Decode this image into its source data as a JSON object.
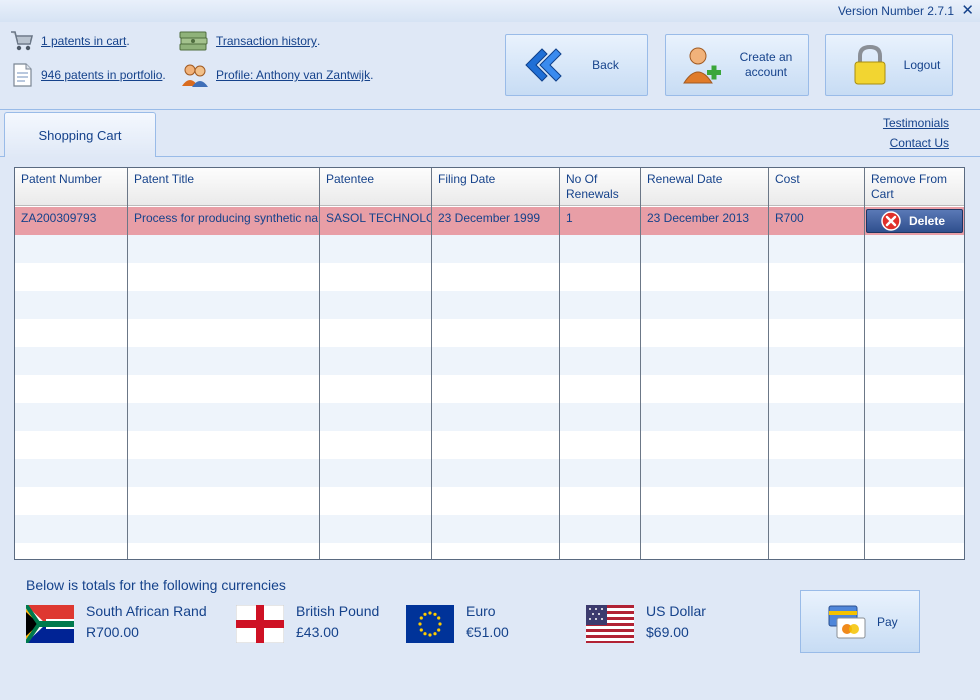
{
  "version": "Version Number 2.7.1",
  "close_glyph": "✕",
  "info": {
    "cart": "1 patents in cart",
    "portfolio": "946 patents in portfolio",
    "transactions": "Transaction history",
    "profile": "Profile: Anthony van Zantwijk",
    "dot": "."
  },
  "buttons": {
    "back": "Back",
    "create_line1": "Create an",
    "create_line2": "account",
    "logout": "Logout",
    "pay": "Pay",
    "delete": "Delete"
  },
  "tabs": {
    "shopping_cart": "Shopping Cart"
  },
  "links": {
    "testimonials": "Testimonials",
    "contact": "Contact Us"
  },
  "grid": {
    "columns": {
      "patent_number": "Patent Number",
      "patent_title": "Patent Title",
      "patentee": "Patentee",
      "filing_date": "Filing Date",
      "renewals_line1": "No Of",
      "renewals_line2": "Renewals",
      "renewal_date": "Renewal Date",
      "cost": "Cost",
      "remove_line1": "Remove From",
      "remove_line2": "Cart"
    },
    "rows": [
      {
        "patent_number": "ZA200309793",
        "patent_title": "Process for producing synthetic na",
        "patentee": "SASOL TECHNOLOGY",
        "filing_date": "23 December 1999",
        "renewals": "1",
        "renewal_date": "23 December 2013",
        "cost": "R700"
      }
    ]
  },
  "totals": {
    "title": "Below is totals for the following currencies",
    "currencies": [
      {
        "name": "South African Rand",
        "value": "R700.00",
        "flag": "south-africa-flag"
      },
      {
        "name": "British Pound",
        "value": "£43.00",
        "flag": "england-flag"
      },
      {
        "name": "Euro",
        "value": "€51.00",
        "flag": "eu-flag"
      },
      {
        "name": "US Dollar",
        "value": "$69.00",
        "flag": "usa-flag"
      }
    ]
  },
  "colors": {
    "accent": "#15428b",
    "selected_row": "#e89ea6",
    "background": "#dfe8f6",
    "border": "#99bbe8"
  }
}
